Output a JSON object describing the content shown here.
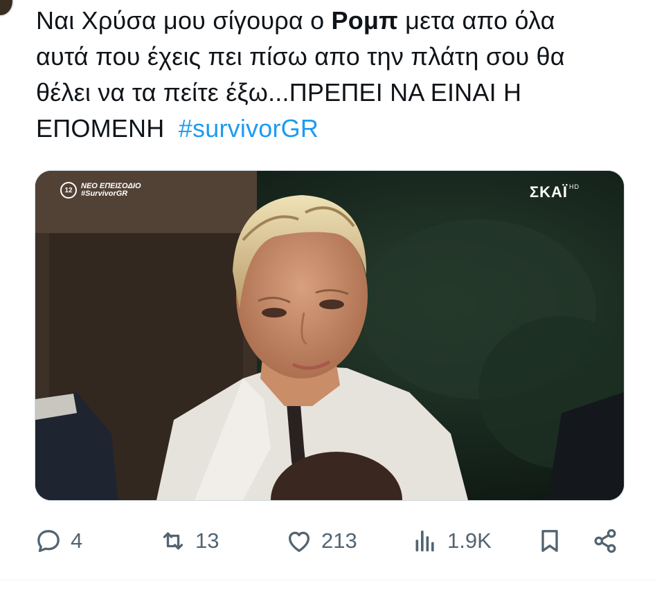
{
  "tweet": {
    "text_line1_pre": "Ναι Χρύσα μου σίγουρα ο ",
    "text_bold": "Ρομπ",
    "text_line1_post": " μετα απο όλα",
    "text_line2": "αυτά που έχεις πει πίσω απο την πλάτη σου θα",
    "text_line3": "θέλει να τα πείτε έξω...ΠΡΕΠΕΙ ΝΑ ΕΙΝΑΙ Η",
    "text_line4": "ΕΠΟΜΕΝΗ ",
    "hashtag": "#survivorGR"
  },
  "media": {
    "overlay_badge": "12",
    "overlay_line1": "ΝΕΟ ΕΠΕΙΣΟΔΙΟ",
    "overlay_line2": "#SurvivorGR",
    "channel_logo": "ΣΚΑΪ",
    "channel_hd": "HD"
  },
  "actions": {
    "replies": "4",
    "reposts": "13",
    "likes": "213",
    "views": "1.9K"
  },
  "colors": {
    "text": "#0f1419",
    "hashtag": "#1d9bf0",
    "icon": "#536471"
  },
  "icons": [
    "reply-icon",
    "repost-icon",
    "like-icon",
    "views-icon",
    "bookmark-icon",
    "share-icon"
  ]
}
